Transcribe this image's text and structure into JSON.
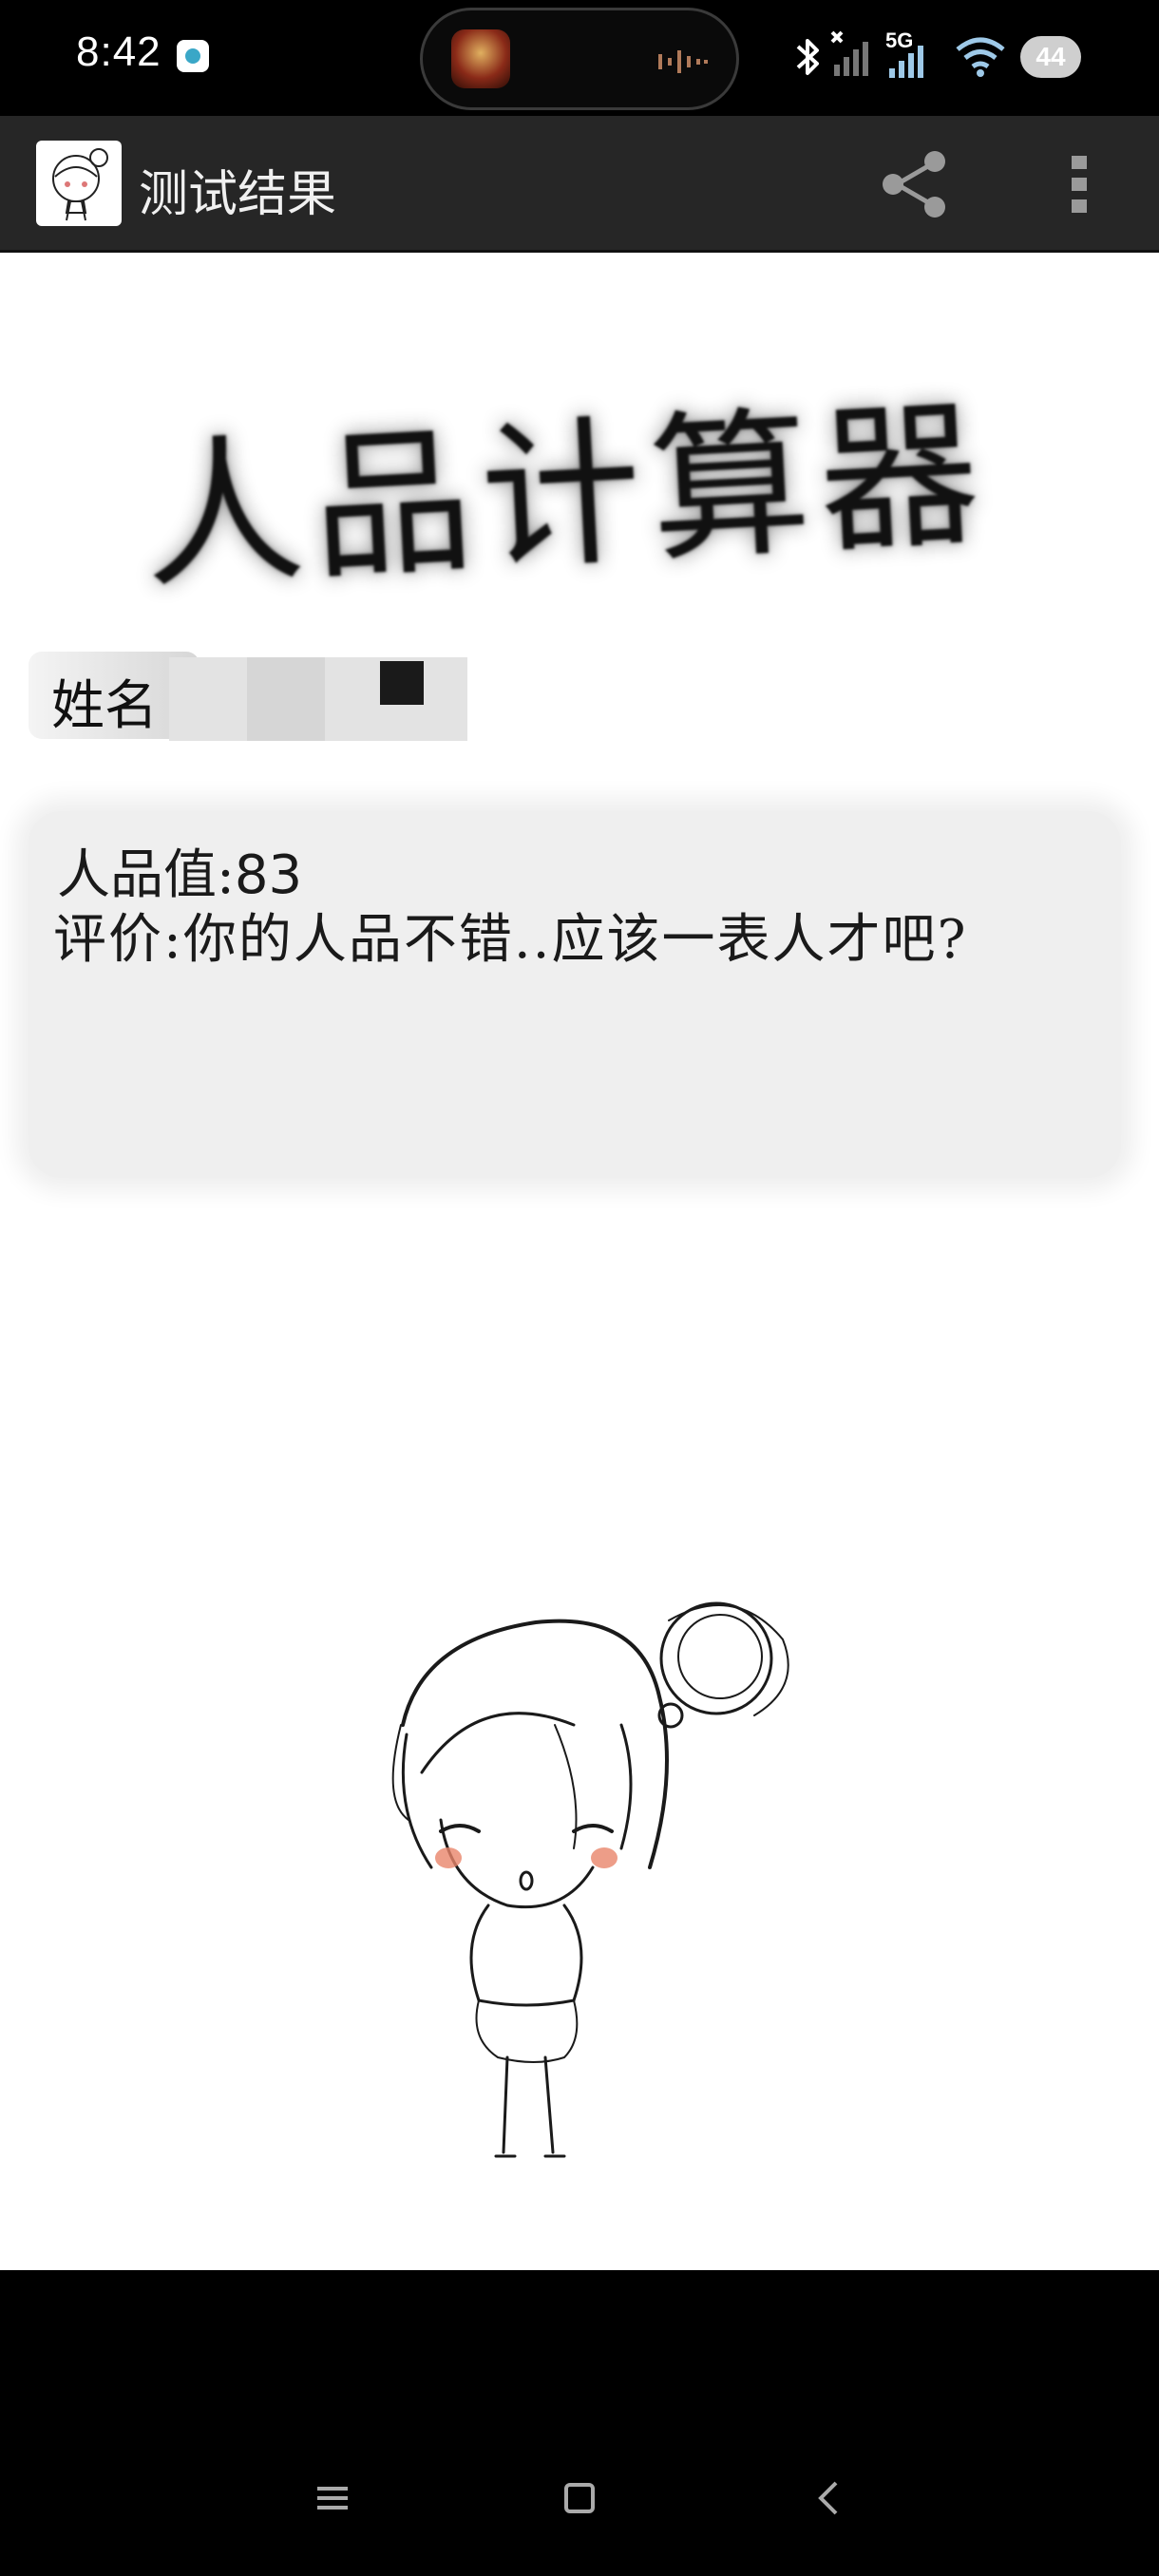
{
  "status_bar": {
    "time": "8:42",
    "network_label": "5G",
    "battery": "44",
    "icons": [
      "notification-app-icon",
      "bluetooth-icon",
      "no-sim-signal-icon",
      "5g-signal-icon",
      "wifi-icon",
      "battery-icon"
    ]
  },
  "app_bar": {
    "title": "测试结果",
    "icons": [
      "app-avatar-icon",
      "share-icon",
      "more-vert-icon"
    ]
  },
  "content": {
    "calc_title": "人品计算器",
    "name_label": "姓名",
    "score_label": "人品值:",
    "score_value": "83",
    "comment_label": "评价:",
    "comment_text": "你的人品不错..应该一表人才吧?"
  },
  "nav_bar": {
    "icons": [
      "menu-icon",
      "home-icon",
      "back-icon"
    ]
  }
}
